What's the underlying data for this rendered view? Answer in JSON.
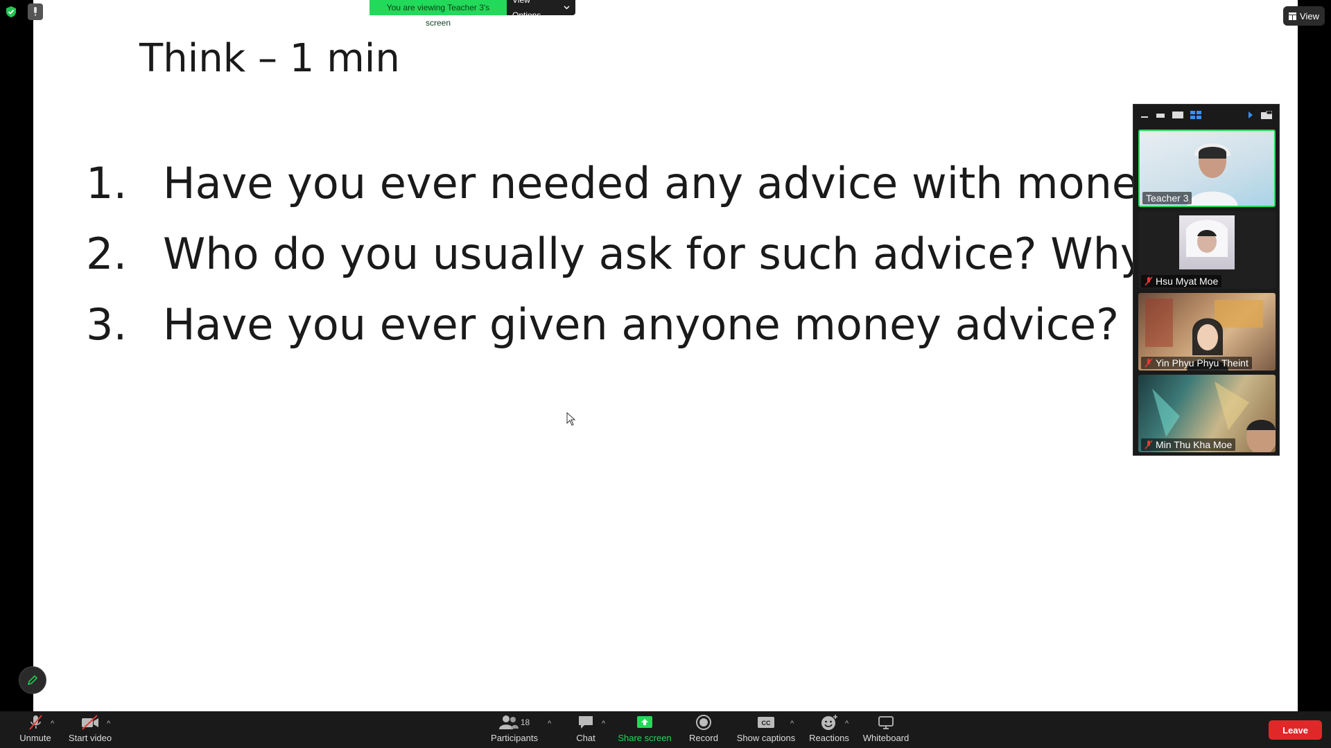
{
  "banner": {
    "text": "You are viewing Teacher 3's screen",
    "view_options": "View Options"
  },
  "top_right": {
    "view_label": "View"
  },
  "slide": {
    "title": "Think – 1 min",
    "questions": [
      {
        "num": "1.",
        "text": "Have you ever needed any advice with money?"
      },
      {
        "num": "2.",
        "text": "Who do you usually ask for such advice? Why?"
      },
      {
        "num": "3.",
        "text": "Have you ever given anyone money advice?"
      }
    ]
  },
  "participants_panel": {
    "tiles": [
      {
        "name": "Teacher 3",
        "muted": false,
        "active_speaker": true
      },
      {
        "name": "Hsu Myat Moe",
        "muted": true
      },
      {
        "name": "Yin Phyu Phyu Theint",
        "muted": true
      },
      {
        "name": "Min Thu Kha Moe",
        "muted": true
      }
    ]
  },
  "toolbar": {
    "unmute": "Unmute",
    "start_video": "Start video",
    "participants": "Participants",
    "participants_count": "18",
    "chat": "Chat",
    "share_screen": "Share screen",
    "record": "Record",
    "show_captions": "Show captions",
    "reactions": "Reactions",
    "whiteboard": "Whiteboard",
    "leave": "Leave"
  },
  "colors": {
    "accent_green": "#23d959",
    "leave_red": "#e02828",
    "toolbar_bg": "#1a1a1a"
  }
}
